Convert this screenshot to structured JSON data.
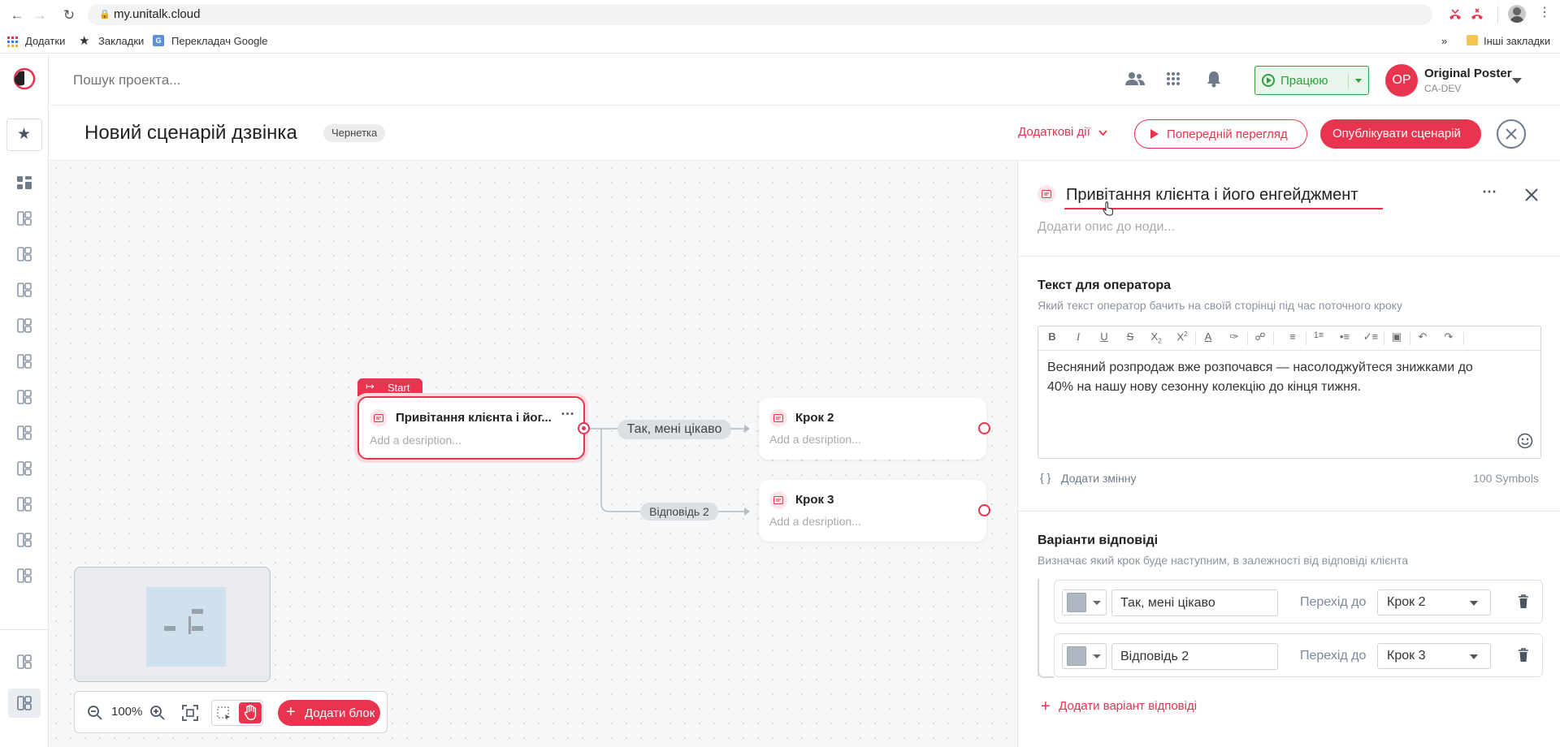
{
  "browser": {
    "url": "my.unitalk.cloud",
    "bookmarks": [
      {
        "label": "Додатки"
      },
      {
        "label": "Закладки"
      },
      {
        "label": "Перекладач Google"
      }
    ],
    "overflow": "»",
    "other_bookmarks": "Інші закладки"
  },
  "topbar": {
    "search_placeholder": "Пошук проекта...",
    "status_label": "Працюю",
    "status_color": "#2e9e3f",
    "user_initials": "OP",
    "user_name": "Original Poster",
    "user_org": "CA-DEV"
  },
  "scenario": {
    "title": "Новий сценарій дзвінка",
    "badge": "Чернетка",
    "more_actions": "Додаткові дії",
    "preview_label": "Попередній перегляд",
    "publish_label": "Опублікувати сценарій",
    "accent_color": "#e8344f"
  },
  "canvas": {
    "start_label": "Start",
    "nodes": [
      {
        "title": "Привітання клієнта і йог...",
        "desc": "Add a desription..."
      },
      {
        "title": "Крок 2",
        "desc": "Add a desription..."
      },
      {
        "title": "Крок 3",
        "desc": "Add a desription..."
      }
    ],
    "edges": [
      {
        "label": "Так, мені цікаво"
      },
      {
        "label": "Відповідь 2"
      }
    ],
    "zoom": "100%",
    "add_block_label": "Додати блок"
  },
  "panel": {
    "node_title": "Привітання клієнта і його енгейджмент",
    "desc_placeholder": "Додати опис до ноди...",
    "operator_text": {
      "heading": "Текст для оператора",
      "subheading": "Який текст оператор бачить на своїй сторінці під час поточного кроку",
      "body": "Весняний розпродаж вже розпочався — насолоджуйтеся знижками до 40% на нашу нову сезонну колекцію до кінця тижня.",
      "add_variable": "Додати змінну",
      "symbols": "100 Symbols"
    },
    "answers": {
      "heading": "Варіанти відповіді",
      "subheading": "Визначає який крок буде наступним, в залежності від відповіді клієнта",
      "goto_label": "Перехід до",
      "items": [
        {
          "value": "Так, мені цікаво",
          "target": "Крок 2"
        },
        {
          "value": "Відповідь 2",
          "target": "Крок 3"
        }
      ],
      "add_label": "Додати варіант відповіді"
    }
  }
}
